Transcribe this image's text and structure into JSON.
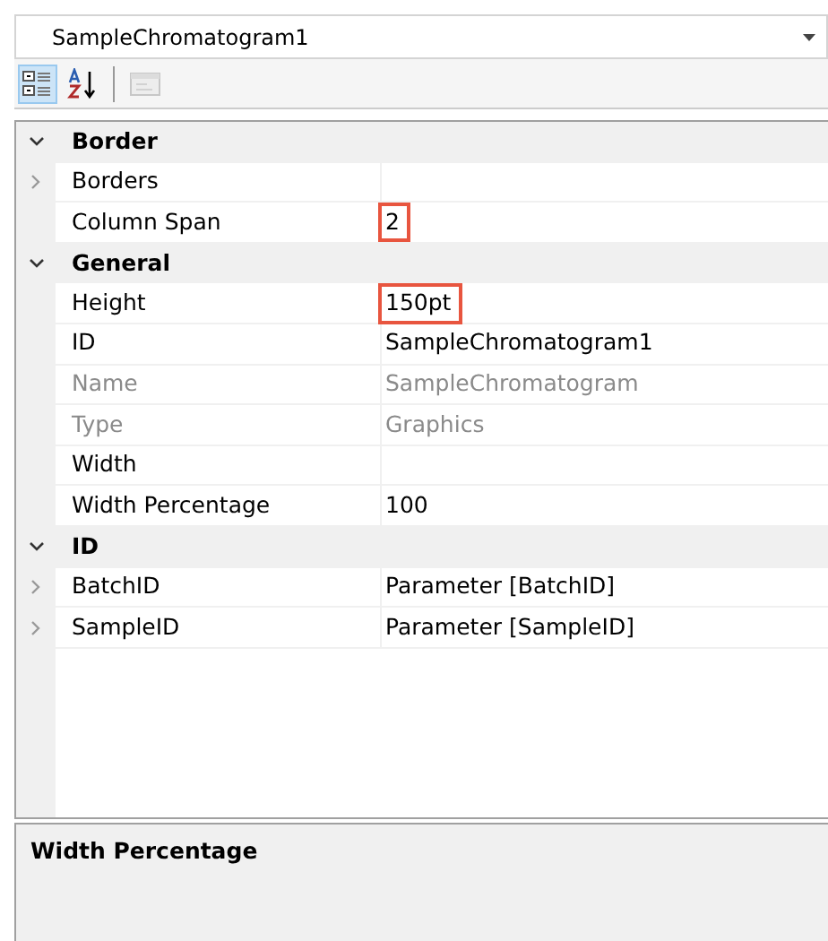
{
  "object_selector": {
    "value": "SampleChromatogram1"
  },
  "toolbar": [
    {
      "kind": "categorized",
      "selected": true,
      "disabled": false
    },
    {
      "kind": "alphabetical",
      "selected": false,
      "disabled": false
    },
    {
      "kind": "separator"
    },
    {
      "kind": "pages",
      "selected": false,
      "disabled": true
    }
  ],
  "grid": [
    {
      "kind": "category",
      "label": "Border",
      "expanded": true
    },
    {
      "kind": "property",
      "label": "Borders",
      "expandable": true,
      "disabled": false
    },
    {
      "kind": "property",
      "label": "Column Span",
      "value": "2",
      "expandable": false,
      "disabled": false,
      "highlighted": true
    },
    {
      "kind": "category",
      "label": "General",
      "expanded": true
    },
    {
      "kind": "property",
      "label": "Height",
      "value": "150pt",
      "expandable": false,
      "disabled": false,
      "highlighted": true
    },
    {
      "kind": "property",
      "label": "ID",
      "value": "SampleChromatogram1",
      "expandable": false,
      "disabled": false,
      "highlighted": false
    },
    {
      "kind": "property",
      "label": "Name",
      "value": "SampleChromatogram",
      "expandable": false,
      "disabled": true,
      "highlighted": false
    },
    {
      "kind": "property",
      "label": "Type",
      "value": "Graphics",
      "expandable": false,
      "disabled": true,
      "highlighted": false
    },
    {
      "kind": "property",
      "label": "Width",
      "expandable": false,
      "disabled": false
    },
    {
      "kind": "property",
      "label": "Width Percentage",
      "value": "100",
      "expandable": false,
      "disabled": false,
      "highlighted": false
    },
    {
      "kind": "category",
      "label": "ID",
      "expanded": true
    },
    {
      "kind": "property",
      "label": "BatchID",
      "value": "Parameter [BatchID]",
      "expandable": true,
      "disabled": false,
      "highlighted": false
    },
    {
      "kind": "property",
      "label": "SampleID",
      "value": "Parameter [SampleID]",
      "expandable": true,
      "disabled": false,
      "highlighted": false
    }
  ],
  "description": {
    "title": "Width Percentage"
  }
}
